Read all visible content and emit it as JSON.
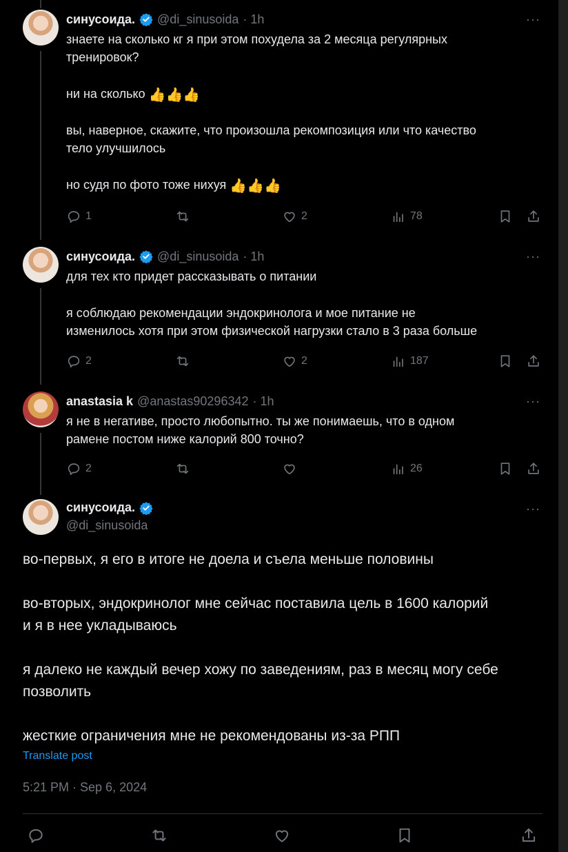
{
  "author": {
    "name": "синусоида.",
    "handle": "@di_sinusoida",
    "time": "· 1h"
  },
  "reply_author": {
    "name": "anastasia k",
    "handle": "@anastas90296342",
    "time": "· 1h"
  },
  "more_glyph": "···",
  "post1": {
    "lines": [
      "знаете на сколько кг я при этом похудела за 2 месяца регулярных",
      "тренировок?",
      "ни на сколько",
      "вы, наверное, скажите, что произошла рекомпозиция или что качество",
      "тело улучшилось",
      "но судя по фото тоже нихуя"
    ],
    "emoji": "👍👍👍",
    "replies": "1",
    "retweets": "",
    "likes": "2",
    "views": "78"
  },
  "post2": {
    "lines": [
      "для тех кто придет рассказывать о питании",
      "я соблюдаю рекомендации эндокринолога и мое питание не",
      "изменилось хотя при этом физической нагрузки стало в 3 раза больше"
    ],
    "replies": "2",
    "retweets": "",
    "likes": "2",
    "views": "187"
  },
  "post3": {
    "lines": [
      "я не в негативе, просто любопытно. ты же понимаешь, что в одном",
      "рамене постом ниже калорий 800 точно?"
    ],
    "replies": "2",
    "retweets": "",
    "likes": "",
    "views": "26"
  },
  "main_post": {
    "lines": [
      "во-первых, я его в итоге не доела и съела меньше половины",
      "во-вторых, эндокринолог мне сейчас поставила цель в 1600 калорий",
      "и я в нее укладываюсь",
      "я далеко не каждый вечер хожу по заведениям, раз в месяц могу себе",
      "позволить",
      "жесткие ограничения мне не рекомендованы из-за РПП"
    ],
    "translate_label": "Translate post",
    "timestamp": "5:21 PM · Sep 6, 2024"
  },
  "colors": {
    "background": "#000000",
    "text": "#e7e9ea",
    "muted": "#71767b",
    "accent": "#1d9bf0"
  },
  "icons": [
    "reply-icon",
    "retweet-icon",
    "like-icon",
    "views-icon",
    "bookmark-icon",
    "share-icon",
    "verified-badge-icon",
    "more-icon"
  ]
}
